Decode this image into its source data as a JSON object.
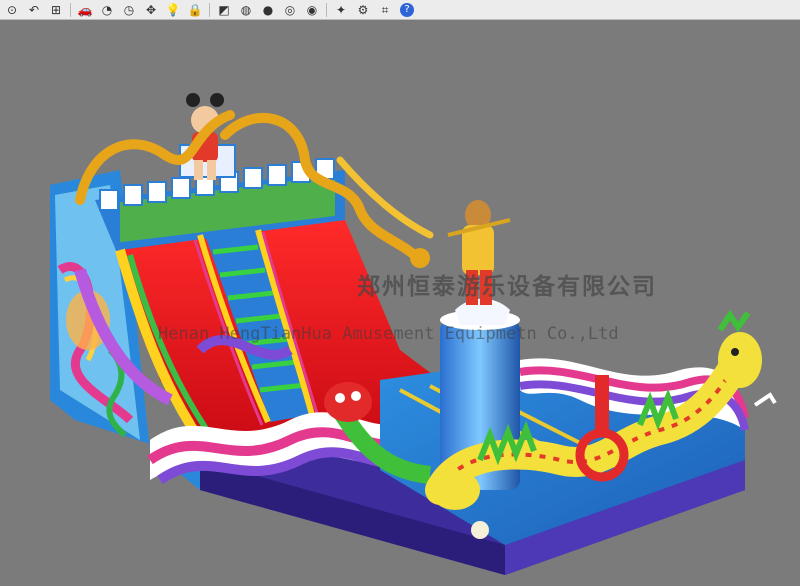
{
  "toolbar": {
    "items": [
      {
        "name": "zoom-icon",
        "glyph": "⊙"
      },
      {
        "name": "undo-icon",
        "glyph": "↶"
      },
      {
        "name": "grid-icon",
        "glyph": "⊞"
      },
      {
        "name": "car-icon",
        "glyph": "🚗"
      },
      {
        "name": "measure-icon",
        "glyph": "◔"
      },
      {
        "name": "clock-icon",
        "glyph": "◷"
      },
      {
        "name": "move-icon",
        "glyph": "✥"
      },
      {
        "name": "light-icon",
        "glyph": "💡"
      },
      {
        "name": "lock-icon",
        "glyph": "🔒"
      },
      {
        "name": "paint-icon",
        "glyph": "◩"
      },
      {
        "name": "color-wheel-icon",
        "glyph": "◍"
      },
      {
        "name": "sphere-flat-icon",
        "glyph": "●"
      },
      {
        "name": "sphere-wire-icon",
        "glyph": "◎"
      },
      {
        "name": "sphere-shaded-icon",
        "glyph": "◉"
      },
      {
        "name": "wand-icon",
        "glyph": "✦"
      },
      {
        "name": "settings-icon",
        "glyph": "⚙"
      },
      {
        "name": "crop-icon",
        "glyph": "⌗"
      },
      {
        "name": "help-icon",
        "glyph": "?"
      }
    ]
  },
  "watermark": {
    "chinese": "郑州恒泰游乐设备有限公司",
    "english": "Henan HengTianHua Amusement Equipmetn Co.,Ltd"
  },
  "colors": {
    "viewport_bg": "#7b7b7b",
    "base_purple": "#3b2a9a",
    "slide_red": "#e8141e",
    "castle_blue": "#2a7ed6",
    "dragon_yellow": "#f3e03a"
  }
}
